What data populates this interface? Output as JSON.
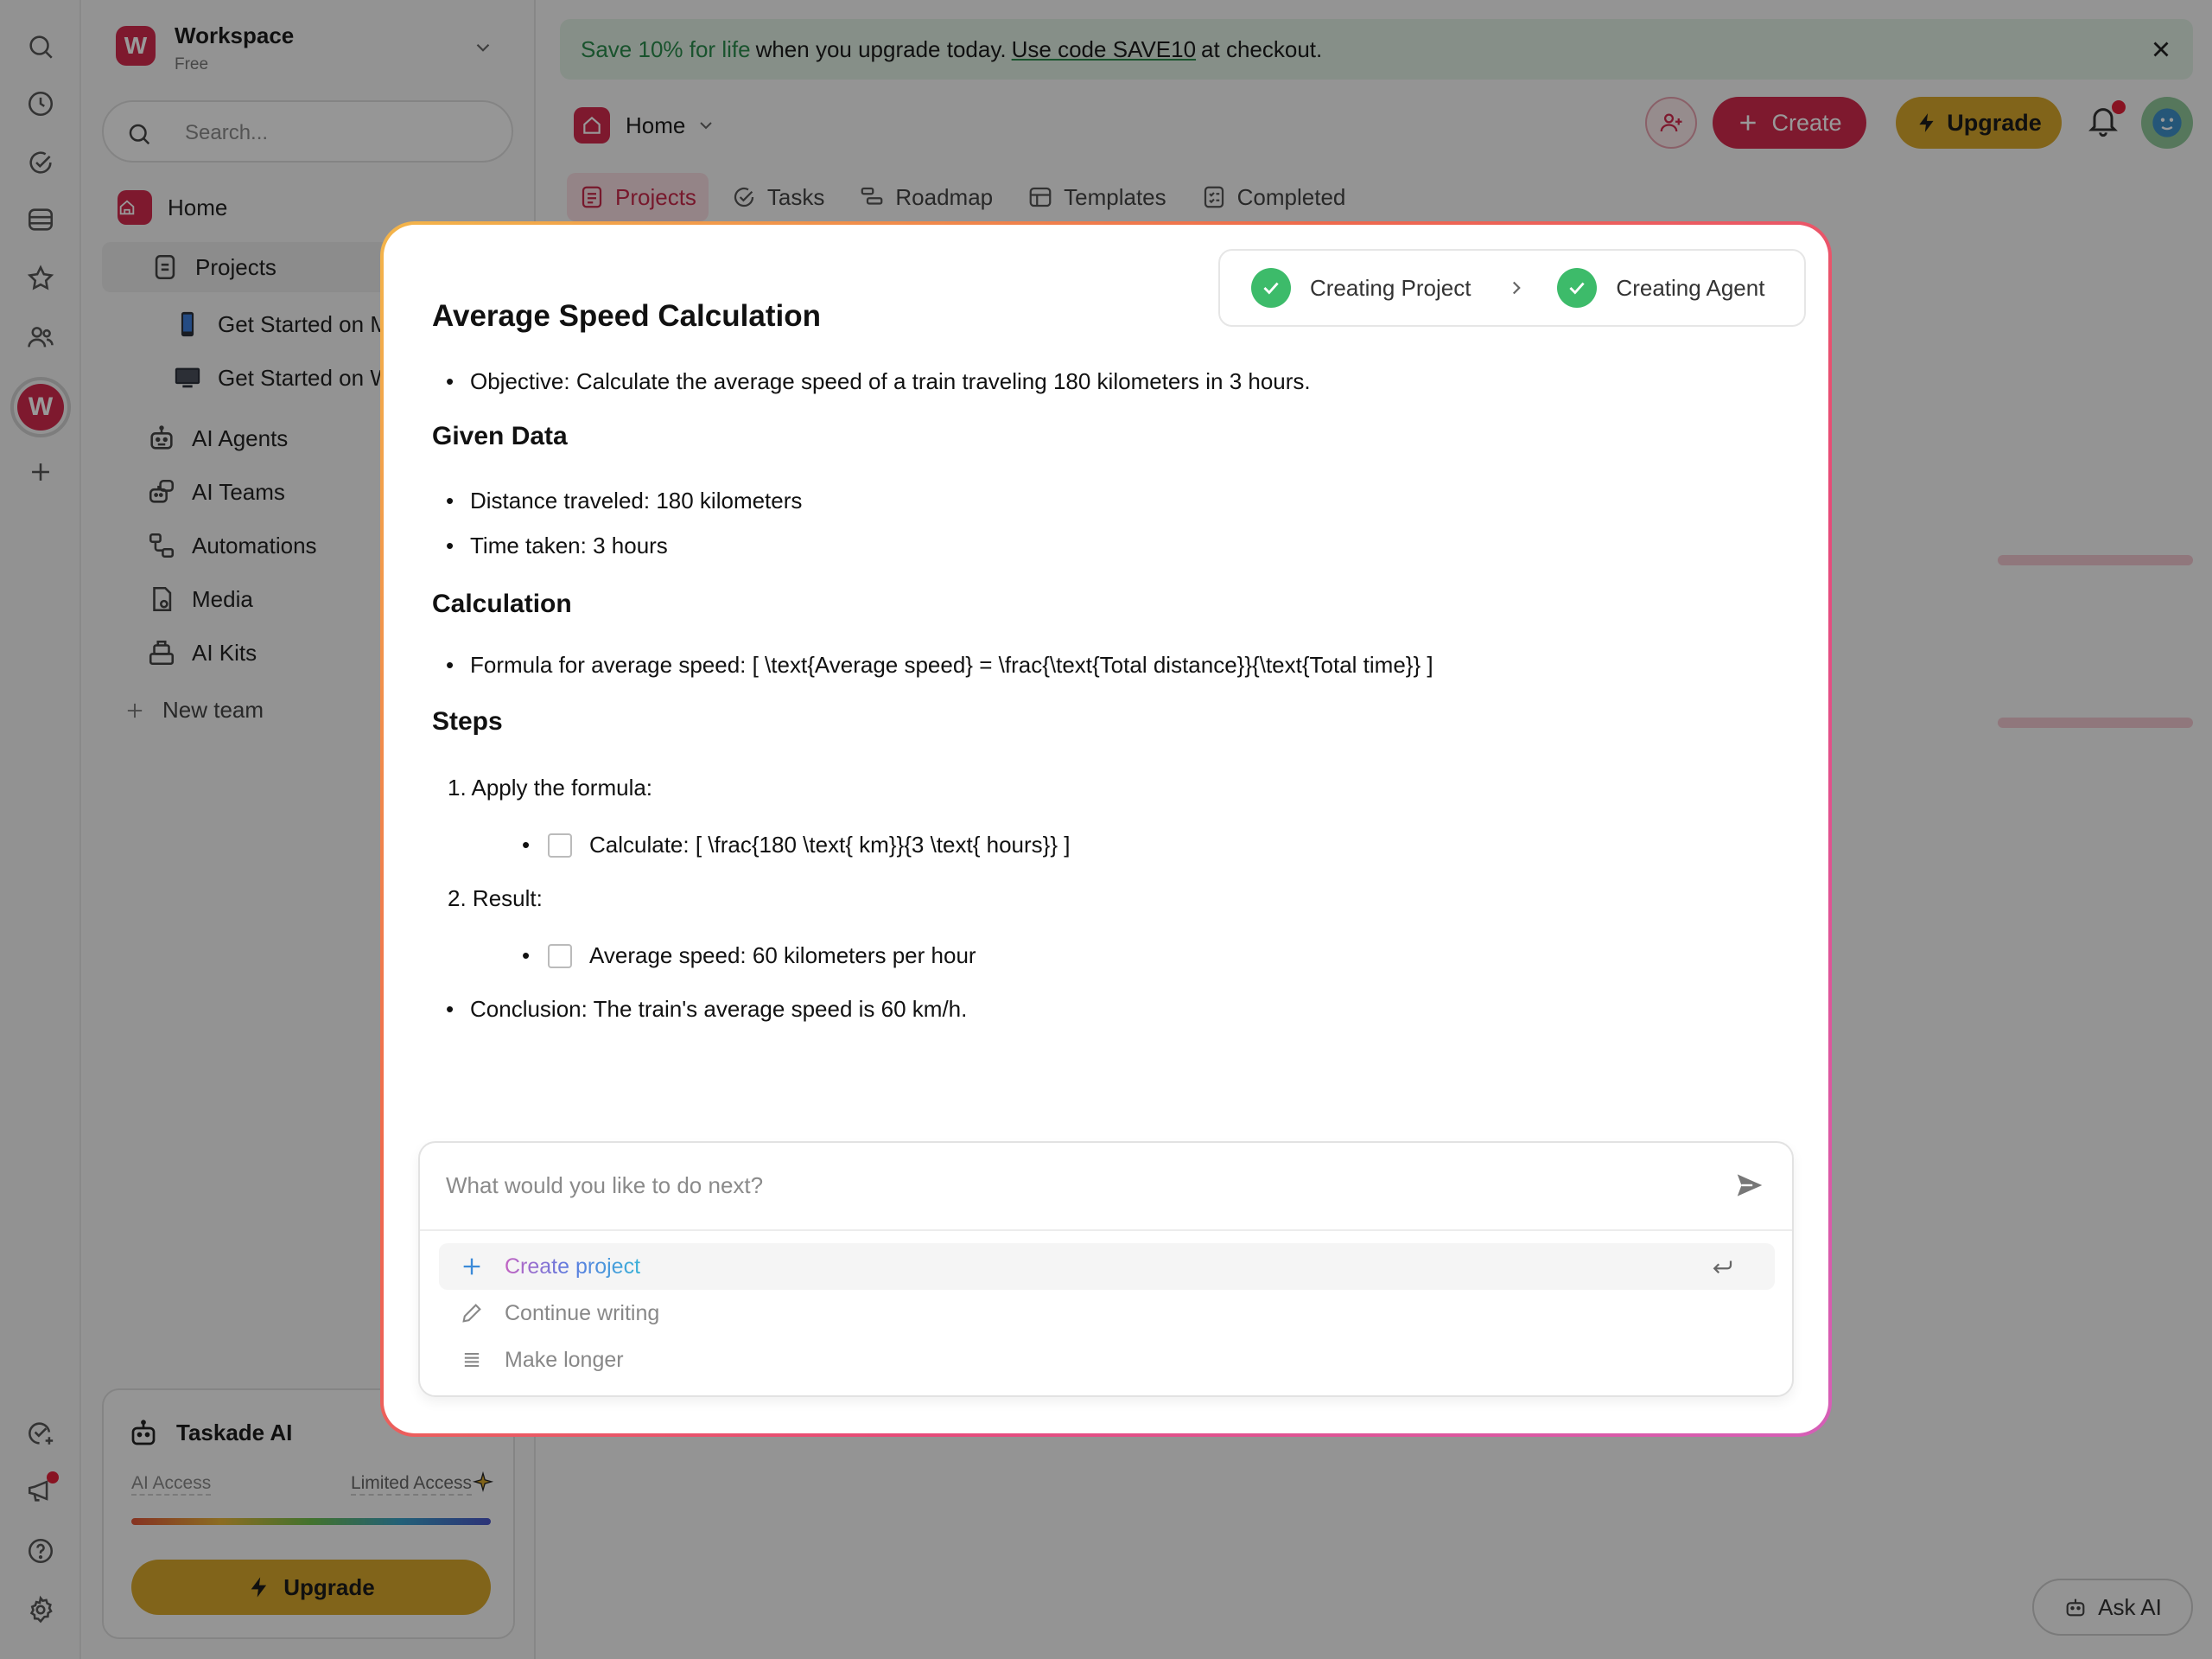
{
  "sidebar": {
    "workspace_initial": "W",
    "workspace_name": "Workspace",
    "workspace_plan": "Free",
    "search_placeholder": "Search...",
    "items": [
      {
        "label": "Home"
      },
      {
        "label": "Projects"
      },
      {
        "label": "Get Started on M"
      },
      {
        "label": "Get Started on W"
      },
      {
        "label": "AI Agents"
      },
      {
        "label": "AI Teams"
      },
      {
        "label": "Automations"
      },
      {
        "label": "Media"
      },
      {
        "label": "AI Kits"
      },
      {
        "label": "New team"
      }
    ],
    "ai_card": {
      "title": "Taskade AI",
      "access_label": "AI Access",
      "access_value": "Limited Access",
      "upgrade_label": "Upgrade"
    }
  },
  "rail": {
    "avatar_initial": "W"
  },
  "banner": {
    "highlight": "Save 10% for life",
    "text": "when you upgrade today.",
    "code_text": "Use code SAVE10",
    "suffix": "at checkout."
  },
  "header": {
    "breadcrumb": "Home",
    "create_label": "Create",
    "upgrade_label": "Upgrade"
  },
  "tabs": [
    {
      "label": "Projects",
      "active": true
    },
    {
      "label": "Tasks"
    },
    {
      "label": "Roadmap"
    },
    {
      "label": "Templates"
    },
    {
      "label": "Completed"
    }
  ],
  "ask_ai_label": "Ask AI",
  "modal": {
    "steps": [
      {
        "label": "Creating Project",
        "status": "done"
      },
      {
        "label": "Creating Agent",
        "status": "done"
      }
    ],
    "doc": {
      "title": "Average Speed Calculation",
      "objective": "Objective: Calculate the average speed of a train traveling 180 kilometers in 3 hours.",
      "given_heading": "Given Data",
      "given": [
        "Distance traveled: 180 kilometers",
        "Time taken: 3 hours"
      ],
      "calc_heading": "Calculation",
      "formula": "Formula for average speed: [ \\text{Average speed} = \\frac{\\text{Total distance}}{\\text{Total time}} ]",
      "steps_heading": "Steps",
      "step1": "Apply the formula:",
      "step1_task": "Calculate: [ \\frac{180 \\text{ km}}{3 \\text{ hours}} ]",
      "step2": "Result:",
      "step2_task": "Average speed: 60 kilometers per hour",
      "conclusion": "Conclusion: The train's average speed is 60 km/h."
    },
    "prompt": {
      "placeholder": "What would you like to do next?",
      "suggestions": [
        {
          "label": "Create project",
          "icon": "plus-icon"
        },
        {
          "label": "Continue writing",
          "icon": "pencil-icon"
        },
        {
          "label": "Make longer",
          "icon": "lines-icon"
        }
      ]
    }
  }
}
